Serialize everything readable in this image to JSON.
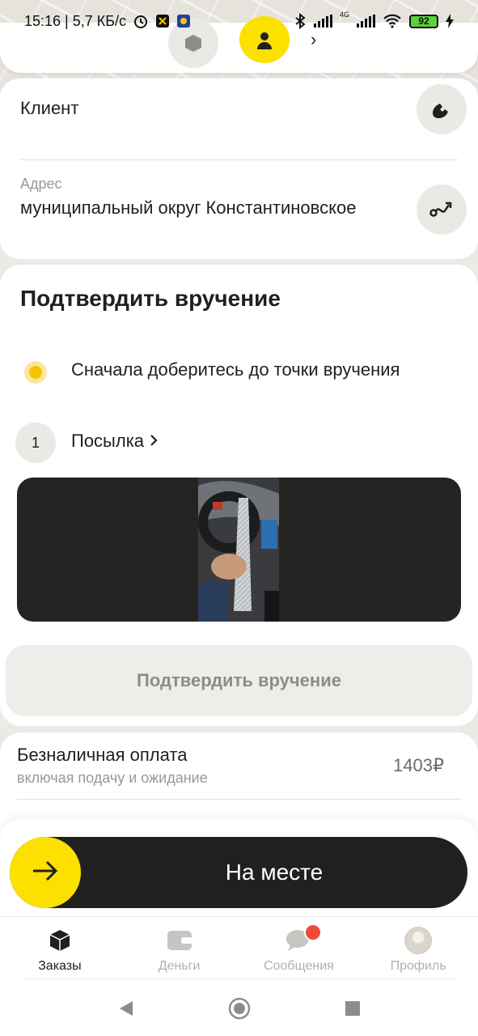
{
  "status_bar": {
    "time_speed": "15:16 | 5,7 КБ/с",
    "network_label": "4G",
    "battery": "92"
  },
  "route": {
    "chevron": "›"
  },
  "client": {
    "label": "Клиент",
    "call_icon": "phone-icon",
    "address_label": "Адрес",
    "address_value": "муниципальный округ Константиновское",
    "route_icon": "route-icon"
  },
  "confirm": {
    "title": "Подтвердить вручение",
    "hint": "Сначала доберитесь до точки вручения",
    "parcel_number": "1",
    "parcel_label": "Посылка",
    "button_label": "Подтвердить вручение"
  },
  "payment": {
    "title": "Безналичная оплата",
    "subtitle": "включая подачу и ожидание",
    "amount": "1403₽"
  },
  "slider": {
    "label": "На месте"
  },
  "tabs": [
    {
      "label": "Заказы",
      "icon": "box-icon",
      "active": true
    },
    {
      "label": "Деньги",
      "icon": "wallet-icon",
      "active": false
    },
    {
      "label": "Сообщения",
      "icon": "chat-icon",
      "active": false
    },
    {
      "label": "Профиль",
      "icon": "avatar",
      "active": false
    }
  ],
  "colors": {
    "accent": "#fce000",
    "dark": "#21201f",
    "notification": "#f04a3c"
  }
}
